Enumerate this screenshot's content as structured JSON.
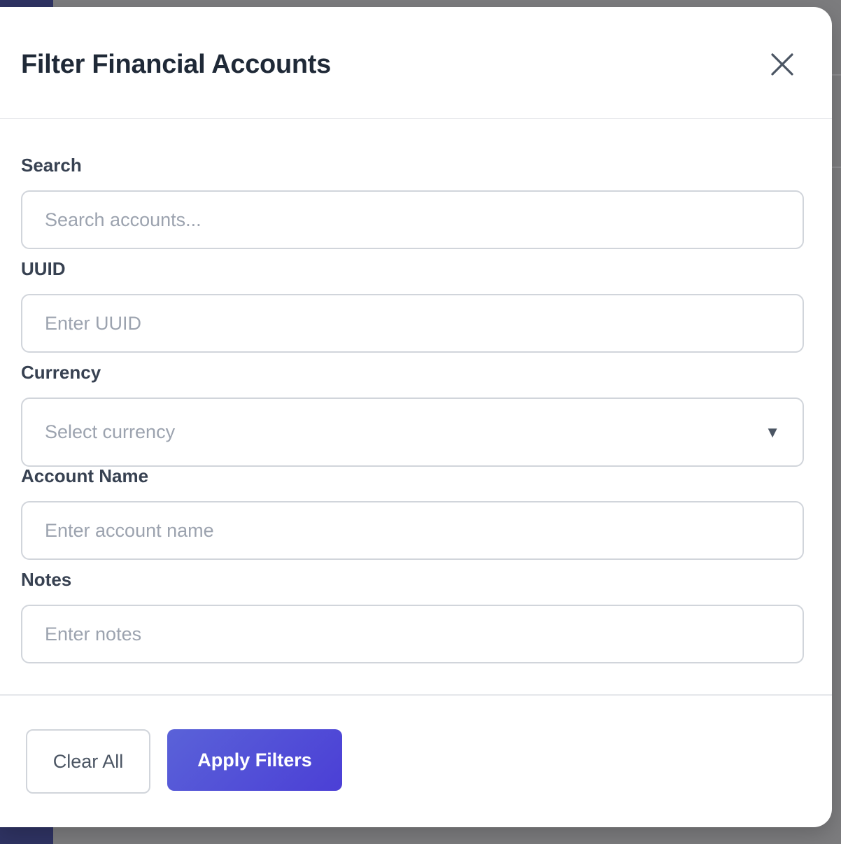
{
  "modal": {
    "title": "Filter Financial Accounts",
    "close_icon": "close-icon"
  },
  "filters": {
    "search": {
      "label": "Search",
      "placeholder": "Search accounts...",
      "value": ""
    },
    "uuid": {
      "label": "UUID",
      "placeholder": "Enter UUID",
      "value": ""
    },
    "currency": {
      "label": "Currency",
      "selected": "Select currency",
      "arrow_icon": "dropdown-arrow-icon"
    },
    "account_name": {
      "label": "Account Name",
      "placeholder": "Enter account name",
      "value": ""
    },
    "notes": {
      "label": "Notes",
      "placeholder": "Enter notes",
      "value": ""
    }
  },
  "footer": {
    "clear_label": "Clear All",
    "apply_label": "Apply Filters"
  },
  "colors": {
    "accent": "#4f46e5",
    "backdrop": "#7c7c7e",
    "sidebar": "#2f3363"
  }
}
